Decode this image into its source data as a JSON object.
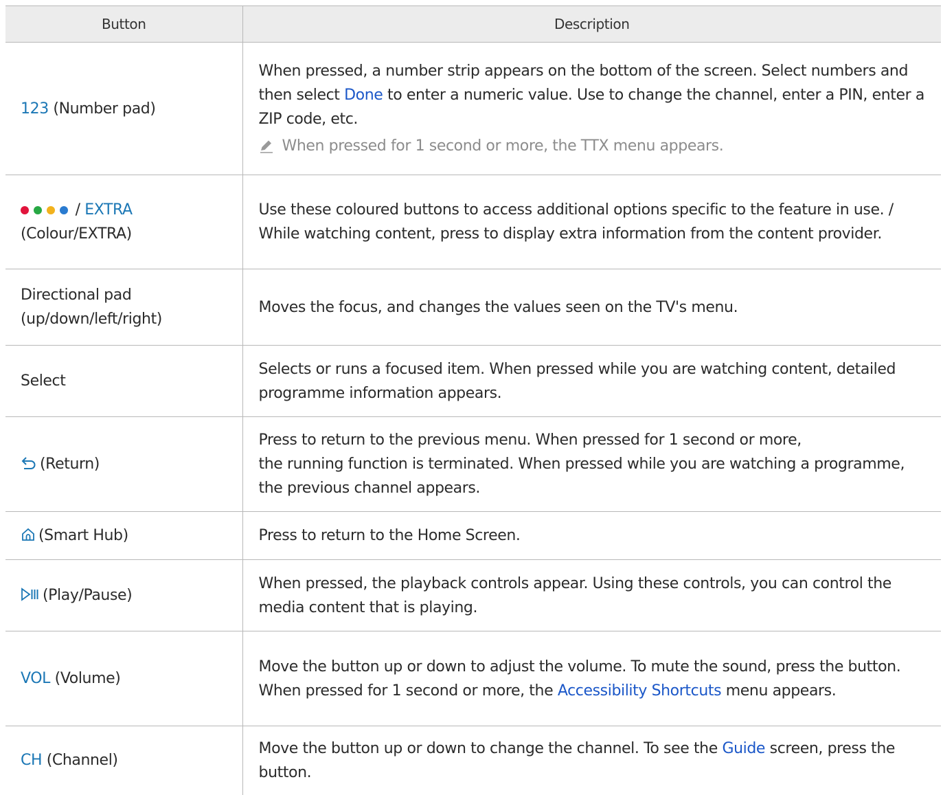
{
  "table": {
    "headers": {
      "button": "Button",
      "description": "Description"
    },
    "rows": [
      {
        "key": "123",
        "key_rest": " (Number pad)",
        "desc_1": "When pressed, a number strip appears on the bottom of the screen. Select numbers and then select ",
        "desc_link": "Done",
        "desc_2": " to enter a numeric value. Use to change the channel, enter a PIN, enter a ZIP code, etc.",
        "note": "When pressed for 1 second or more, the TTX menu appears."
      },
      {
        "key_sep": " / ",
        "key": "EXTRA",
        "key_line2": "(Colour/EXTRA)",
        "dot_colors": [
          "#e1143c",
          "#27a844",
          "#f2b21d",
          "#2a7bd0"
        ],
        "desc": "Use these coloured buttons to access additional options specific to the feature in use. / While watching content, press to display extra information from the content provider."
      },
      {
        "key_line1": "Directional pad",
        "key_line2": "(up/down/left/right)",
        "desc": "Moves the focus, and changes the values seen on the TV's menu."
      },
      {
        "key": "Select",
        "desc": "Selects or runs a focused item. When pressed while you are watching content, detailed programme information appears."
      },
      {
        "icon": "return-icon",
        "key_rest": "(Return)",
        "desc_line1": "Press to return to the previous menu. When pressed for 1 second or more,",
        "desc_line2": "the running function is terminated. When pressed while you are watching a programme, the previous channel appears."
      },
      {
        "icon": "home-icon",
        "key_rest": "(Smart Hub)",
        "desc": "Press to return to the Home Screen."
      },
      {
        "icon": "play-pause-icon",
        "key_rest": "(Play/Pause)",
        "desc": "When pressed, the playback controls appear. Using these controls, you can control the media content that is playing."
      },
      {
        "key": "VOL",
        "key_rest": " (Volume)",
        "desc_1": "Move the button up or down to adjust the volume. To mute the sound, press the button. When pressed for 1 second or more, the ",
        "desc_link": "Accessibility Shortcuts",
        "desc_2": " menu appears."
      },
      {
        "key": "CH",
        "key_rest": " (Channel)",
        "desc_1": "Move the button up or down to change the channel. To see the ",
        "desc_link": "Guide",
        "desc_2": " screen, press the button."
      }
    ]
  },
  "colors": {
    "keyword": "#1b77b5",
    "link": "#1b57c8",
    "header_bg": "#ececec",
    "border": "#b8b8b8",
    "note": "#8c8c8c"
  }
}
